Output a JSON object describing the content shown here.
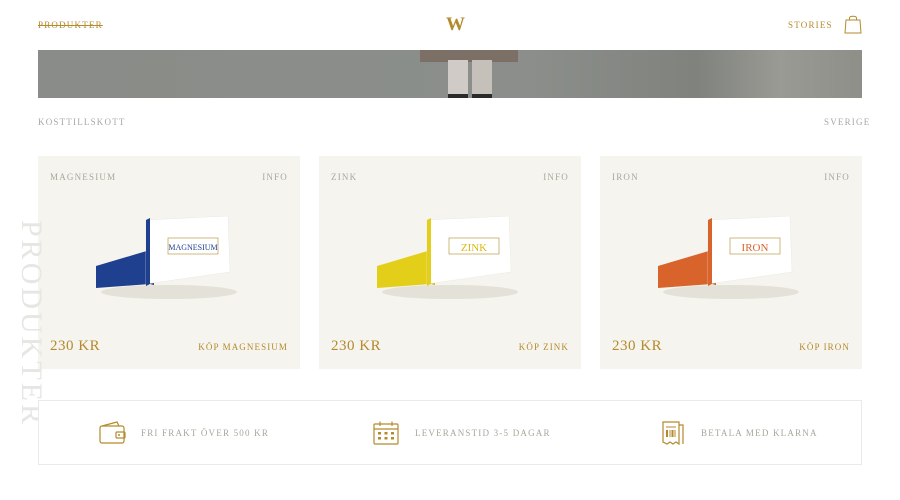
{
  "header": {
    "left_link": "PRODUKTER",
    "logo": "W",
    "right_link": "STORIES",
    "cart_icon": "shopping-bag-icon"
  },
  "section": {
    "left_label": "KOSTTILLSKOTT",
    "right_label": "SVERIGE",
    "vertical_label": "PRODUKTER"
  },
  "products": [
    {
      "name": "MAGNESIUM",
      "info": "INFO",
      "price": "230 KR",
      "buy_label": "KÖP MAGNESIUM",
      "box_label": "MAGNESIUM",
      "accent": "#1f3f8f"
    },
    {
      "name": "ZINK",
      "info": "INFO",
      "price": "230 KR",
      "buy_label": "KÖP ZINK",
      "box_label": "ZINK",
      "accent": "#e3cf1a"
    },
    {
      "name": "IRON",
      "info": "INFO",
      "price": "230 KR",
      "buy_label": "KÖP IRON",
      "box_label": "IRON",
      "accent": "#d8642b"
    }
  ],
  "features": [
    {
      "icon": "wallet-icon",
      "label": "FRI FRAKT ÖVER 500 KR"
    },
    {
      "icon": "calendar-icon",
      "label": "LEVERANSTID 3-5 DAGAR"
    },
    {
      "icon": "receipt-icon",
      "label": "BETALA MED KLARNA"
    }
  ],
  "colors": {
    "gold": "#b48a2c",
    "card_bg": "#f6f4ee",
    "muted_text": "#a9a69b"
  }
}
